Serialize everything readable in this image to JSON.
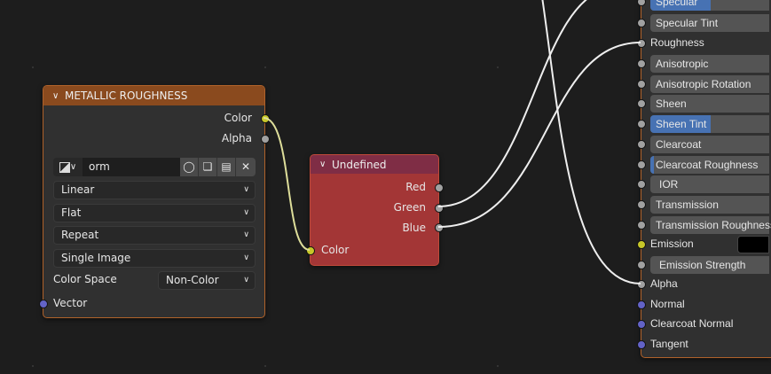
{
  "image_node": {
    "title": "METALLIC ROUGHNESS",
    "outputs": [
      "Color",
      "Alpha"
    ],
    "image_name": "orm",
    "interpolation": "Linear",
    "projection": "Flat",
    "extension": "Repeat",
    "source": "Single Image",
    "color_space_label": "Color Space",
    "color_space": "Non-Color",
    "input": "Vector",
    "colors": {
      "header": "#8a4a1e",
      "body": "#303030"
    }
  },
  "separate_node": {
    "title": "Undefined",
    "outputs": [
      "Red",
      "Green",
      "Blue"
    ],
    "input": "Color",
    "colors": {
      "header": "#7f2d45",
      "body": "#a33636"
    }
  },
  "bsdf_node": {
    "inputs": [
      {
        "label": "Specular",
        "type": "slider",
        "fill": 0.5
      },
      {
        "label": "Specular Tint",
        "type": "slider",
        "fill": 0
      },
      {
        "label": "Roughness",
        "type": "linked"
      },
      {
        "label": "Anisotropic",
        "type": "slider",
        "fill": 0
      },
      {
        "label": "Anisotropic Rotation",
        "type": "slider",
        "fill": 0
      },
      {
        "label": "Sheen",
        "type": "slider",
        "fill": 0
      },
      {
        "label": "Sheen Tint",
        "type": "slider",
        "fill": 0.5
      },
      {
        "label": "Clearcoat",
        "type": "slider",
        "fill": 0
      },
      {
        "label": "Clearcoat Roughness",
        "type": "slider",
        "fill": 0.03
      },
      {
        "label": "IOR",
        "type": "slider",
        "fill": 0
      },
      {
        "label": "Transmission",
        "type": "slider",
        "fill": 0
      },
      {
        "label": "Transmission Roughness",
        "type": "slider",
        "fill": 0
      },
      {
        "label": "Emission",
        "type": "color",
        "value": "#000000"
      },
      {
        "label": "Emission Strength",
        "type": "slider",
        "fill": 0
      },
      {
        "label": "Alpha",
        "type": "linked"
      },
      {
        "label": "Normal",
        "type": "vector"
      },
      {
        "label": "Clearcoat Normal",
        "type": "vector"
      },
      {
        "label": "Tangent",
        "type": "vector"
      }
    ]
  }
}
